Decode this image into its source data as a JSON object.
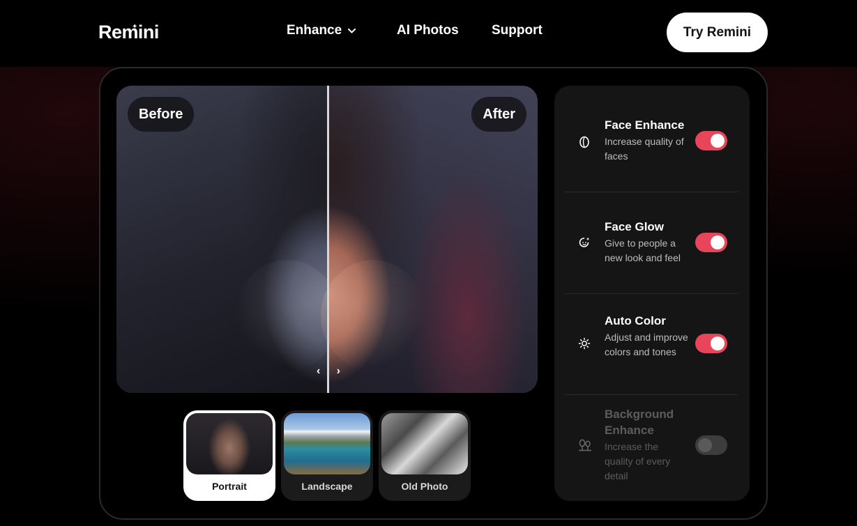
{
  "brand": {
    "name_part1": "Rem",
    "name_part2": "ini"
  },
  "nav": {
    "items": [
      {
        "label": "Enhance"
      },
      {
        "label": "AI Photos"
      },
      {
        "label": "Support"
      }
    ],
    "cta_label": "Try Remini"
  },
  "compare": {
    "before_label": "Before",
    "after_label": "After",
    "slider_position": 0.5
  },
  "samples": [
    {
      "label": "Portrait",
      "selected": true
    },
    {
      "label": "Landscape",
      "selected": false
    },
    {
      "label": "Old Photo",
      "selected": false
    }
  ],
  "features": [
    {
      "title": "Face Enhance",
      "desc": "Increase quality of faces",
      "icon": "face-enhance-icon",
      "enabled": true
    },
    {
      "title": "Face Glow",
      "desc": "Give to people a new look and feel",
      "icon": "face-glow-icon",
      "enabled": true
    },
    {
      "title": "Auto Color",
      "desc": "Adjust and improve colors and tones",
      "icon": "sun-icon",
      "enabled": true
    },
    {
      "title": "Background Enhance",
      "desc": "Increase the quality of every detail",
      "icon": "trees-icon",
      "enabled": false
    }
  ],
  "colors": {
    "accent": "#e8455b",
    "panel": "#151515",
    "background": "#000000"
  }
}
